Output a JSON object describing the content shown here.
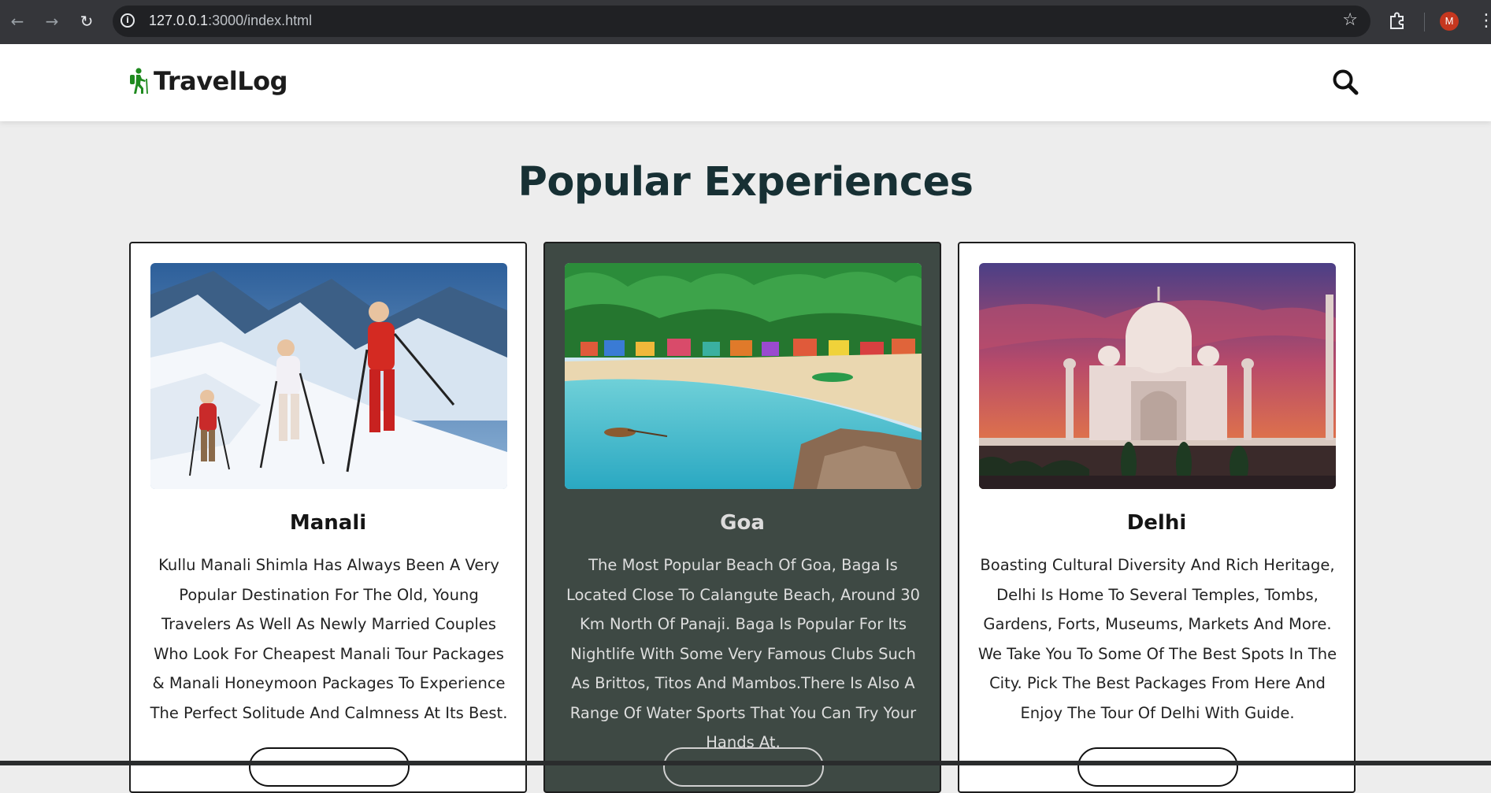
{
  "browser": {
    "url_host": "127.0.0.1",
    "url_rest": ":3000/index.html",
    "avatar_initial": "M"
  },
  "header": {
    "brand": "TravelLog"
  },
  "main": {
    "title": "Popular Experiences",
    "cards": [
      {
        "title": "Manali",
        "description": "Kullu Manali Shimla Has Always Been A Very Popular Destination For The Old, Young Travelers As Well As Newly Married Couples Who Look For Cheapest Manali Tour Packages & Manali Honeymoon Packages To Experience The Perfect Solitude And Calmness At Its Best.",
        "theme": "light"
      },
      {
        "title": "Goa",
        "description": "The Most Popular Beach Of Goa, Baga Is Located Close To Calangute Beach, Around 30 Km North Of Panaji. Baga Is Popular For Its Nightlife With Some Very Famous Clubs Such As Brittos, Titos And Mambos.There Is Also A Range Of Water Sports That You Can Try Your Hands At.",
        "theme": "dark"
      },
      {
        "title": "Delhi",
        "description": "Boasting Cultural Diversity And Rich Heritage, Delhi Is Home To Several Temples, Tombs, Gardens, Forts, Museums, Markets And More. We Take You To Some Of The Best Spots In The City. Pick The Best Packages From Here And Enjoy The Tour Of Delhi With Guide.",
        "theme": "light"
      }
    ]
  },
  "colors": {
    "brand_green": "#1f8a1f",
    "dark_card": "#3e4944",
    "title_color": "#173034"
  },
  "icons": [
    "back-icon",
    "forward-icon",
    "reload-icon",
    "info-icon",
    "star-icon",
    "extensions-icon",
    "menu-icon",
    "hiker-icon",
    "search-icon"
  ]
}
